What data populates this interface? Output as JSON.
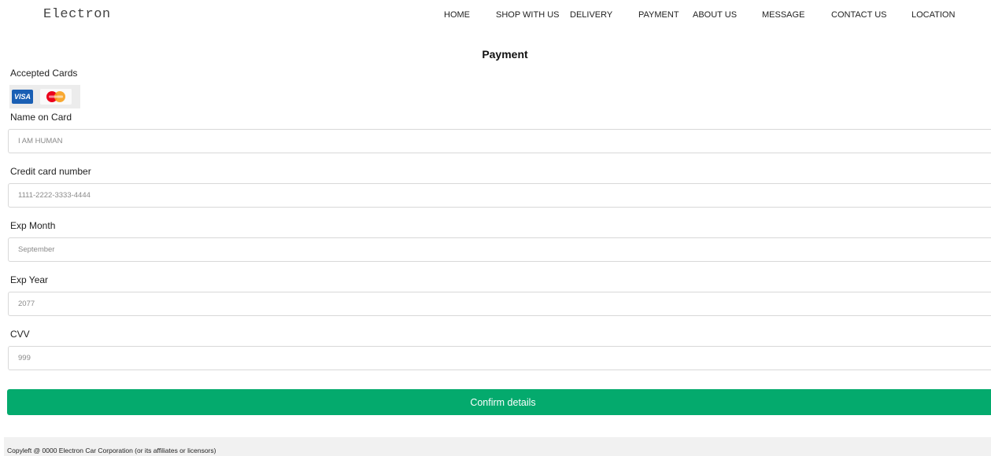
{
  "brand": "Electron",
  "nav": [
    "HOME",
    "SHOP WITH US",
    "DELIVERY",
    "PAYMENT",
    "ABOUT US",
    "MESSAGE",
    "CONTACT US",
    "LOCATION"
  ],
  "page_title": "Payment",
  "accepted_cards": {
    "label": "Accepted Cards",
    "visa_text": "VISA",
    "icons": [
      "visa-icon",
      "mastercard-icon"
    ]
  },
  "fields": [
    {
      "label": "Name on Card",
      "placeholder": "I AM HUMAN"
    },
    {
      "label": "Credit card number",
      "placeholder": "1111-2222-3333-4444"
    },
    {
      "label": "Exp Month",
      "placeholder": "September"
    },
    {
      "label": "Exp Year",
      "placeholder": "2077"
    },
    {
      "label": "CVV",
      "placeholder": "999"
    }
  ],
  "confirm_label": "Confirm details",
  "footer": "Copyleft @ 0000 Electron Car Corporation (or its affiliates or licensors)",
  "colors": {
    "accent": "#04aa6d",
    "visa_blue": "#1a5fb4",
    "mc_red": "#eb001b",
    "mc_orange": "#f79e1b"
  }
}
